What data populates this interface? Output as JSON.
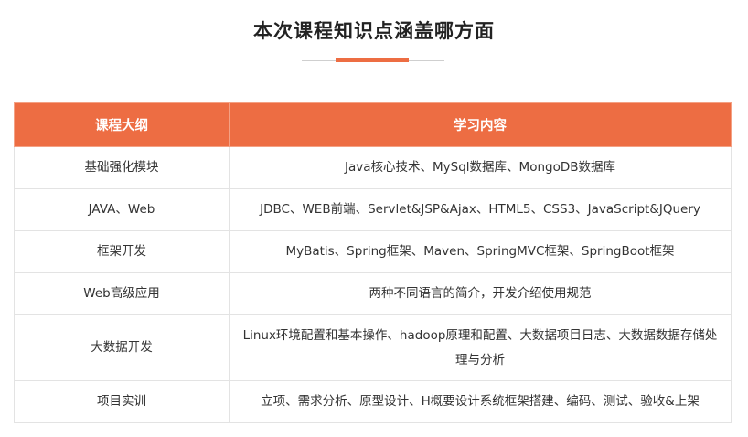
{
  "page": {
    "title": "本次课程知识点涵盖哪方面"
  },
  "table": {
    "headers": [
      "课程大纲",
      "学习内容"
    ],
    "rows": [
      {
        "module": "基础强化模块",
        "content": "Java核心技术、MySql数据库、MongoDB数据库"
      },
      {
        "module": "JAVA、Web",
        "content": "JDBC、WEB前端、Servlet&JSP&Ajax、HTML5、CSS3、JavaScript&JQuery"
      },
      {
        "module": "框架开发",
        "content": "MyBatis、Spring框架、Maven、SpringMVC框架、SpringBoot框架"
      },
      {
        "module": "Web高级应用",
        "content": "两种不同语言的简介，开发介绍使用规范"
      },
      {
        "module": "大数据开发",
        "content": "Linux环境配置和基本操作、hadoop原理和配置、大数据项目日志、大数据数据存储处理与分析"
      },
      {
        "module": "项目实训",
        "content": "立项、需求分析、原型设计、H概要设计系统框架搭建、编码、测试、验收&上架"
      }
    ]
  },
  "colors": {
    "accent": "#ed6d43",
    "header_text": "#ffffff",
    "border": "#e3e3e3"
  }
}
